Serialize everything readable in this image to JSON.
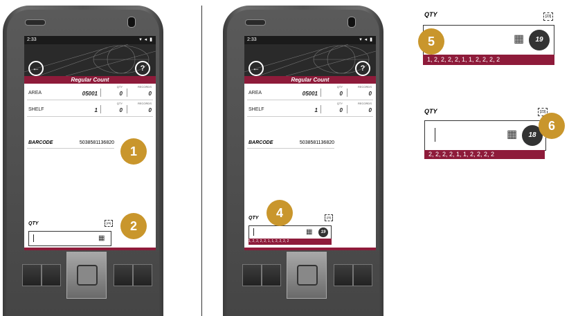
{
  "left_phone": {
    "time": "2:33",
    "status_icons": "▾ ◂ ▮",
    "title": "Regular Count",
    "area": {
      "label": "AREA",
      "value": "05001",
      "qty_header": "QTY",
      "qty": "0",
      "records_header": "RECORDS",
      "records": "0"
    },
    "shelf": {
      "label": "SHELF",
      "value": "1",
      "qty_header": "QTY",
      "qty": "0",
      "records_header": "RECORDS",
      "records": "0"
    },
    "barcode": {
      "label": "BARCODE",
      "value": "5038581136820"
    },
    "qty_label": "QTY",
    "scan_icon": "[23]",
    "back_icon": "←",
    "help_icon": "?",
    "calc_icon": "▦"
  },
  "right_phone": {
    "time": "2:33",
    "status_icons": "▾ ◂ ▮",
    "title": "Regular Count",
    "area": {
      "label": "AREA",
      "value": "05001",
      "qty_header": "QTY",
      "qty": "0",
      "records_header": "RECORDS",
      "records": "0"
    },
    "shelf": {
      "label": "SHELF",
      "value": "1",
      "qty_header": "QTY",
      "qty": "0",
      "records_header": "RECORDS",
      "records": "0"
    },
    "barcode": {
      "label": "BARCODE",
      "value": "5038581136820"
    },
    "qty_label": "QTY",
    "scan_icon": "[23]",
    "count_badge": "19",
    "sequence": "1, 2, 2, 2, 2, 1, 1, 2, 2, 2, 2",
    "back_icon": "←",
    "help_icon": "?",
    "calc_icon": "▦"
  },
  "zoom_top": {
    "qty_label": "QTY",
    "scan_icon": "[23]",
    "count_badge": "19",
    "sequence": "1, 2, 2, 2, 2, 1, 1, 2, 2, 2, 2",
    "calc_icon": "▦"
  },
  "zoom_bottom": {
    "qty_label": "QTY",
    "scan_icon": "[23]",
    "count_badge": "18",
    "sequence": "2, 2, 2, 2, 1, 1, 2, 2, 2, 2",
    "calc_icon": "▦"
  },
  "steps": [
    "1",
    "2",
    "4",
    "5",
    "6"
  ],
  "colors": {
    "accent": "#8e1b3a",
    "step": "#c9962c",
    "badge": "#333333"
  }
}
